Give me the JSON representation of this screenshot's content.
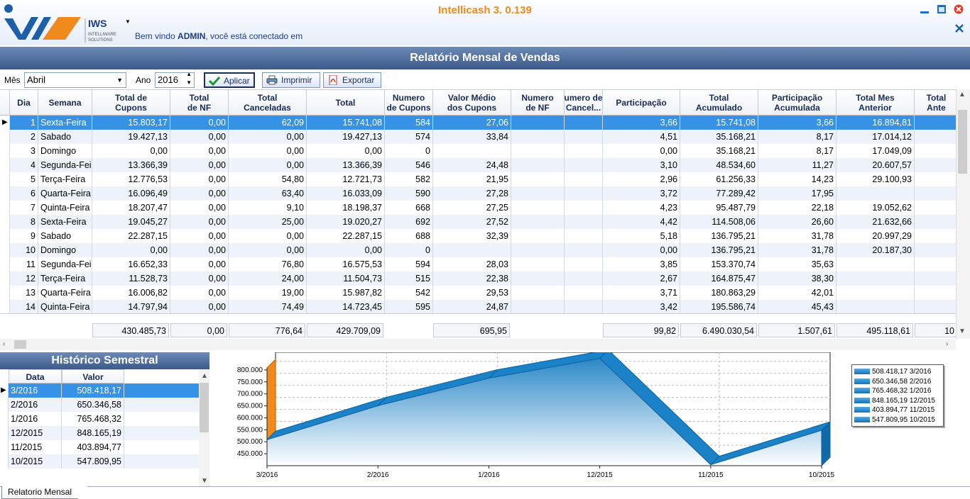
{
  "app": {
    "title": "Intellicash 3. 0.139",
    "logo_text": "IWS",
    "logo_sub1": "INTELLIWARE",
    "logo_sub2": "SOLUTIONS",
    "welcome_prefix": "Bem vindo ",
    "welcome_user": "ADMIN",
    "welcome_suffix": ", você está conectado em"
  },
  "report": {
    "title": "Relatório Mensal de Vendas"
  },
  "toolbar": {
    "mes_label": "Mês",
    "mes_value": "Abril",
    "ano_label": "Ano",
    "ano_value": "2016",
    "aplicar": "Aplicar",
    "imprimir": "Imprimir",
    "exportar": "Exportar"
  },
  "grid": {
    "columns": [
      {
        "l1": "Dia",
        "l2": ""
      },
      {
        "l1": "Semana",
        "l2": ""
      },
      {
        "l1": "Total de",
        "l2": "Cupons"
      },
      {
        "l1": "Total",
        "l2": "de NF"
      },
      {
        "l1": "Total",
        "l2": "Canceladas"
      },
      {
        "l1": "Total",
        "l2": ""
      },
      {
        "l1": "Numero",
        "l2": "de Cupons"
      },
      {
        "l1": "Valor Médio",
        "l2": "dos Cupons"
      },
      {
        "l1": "Numero",
        "l2": "de NF"
      },
      {
        "l1": "umero de",
        "l2": "Cancel..."
      },
      {
        "l1": "Participação",
        "l2": ""
      },
      {
        "l1": "Total",
        "l2": "Acumulado"
      },
      {
        "l1": "Participação",
        "l2": "Acumulada"
      },
      {
        "l1": "Total Mes",
        "l2": "Anterior"
      },
      {
        "l1": "Total",
        "l2": "Ante"
      }
    ],
    "rows": [
      [
        "1",
        "Sexta-Feira",
        "15.803,17",
        "0,00",
        "62,09",
        "15.741,08",
        "584",
        "27,06",
        "",
        "",
        "3,66",
        "15.741,08",
        "3,66",
        "16.894,81",
        ""
      ],
      [
        "2",
        "Sabado",
        "19.427,13",
        "0,00",
        "0,00",
        "19.427,13",
        "574",
        "33,84",
        "",
        "",
        "4,51",
        "35.168,21",
        "8,17",
        "17.014,12",
        ""
      ],
      [
        "3",
        "Domingo",
        "0,00",
        "0,00",
        "0,00",
        "0,00",
        "0",
        "",
        "",
        "",
        "0,00",
        "35.168,21",
        "8,17",
        "17.049,09",
        ""
      ],
      [
        "4",
        "Segunda-Feira",
        "13.366,39",
        "0,00",
        "0,00",
        "13.366,39",
        "546",
        "24,48",
        "",
        "",
        "3,10",
        "48.534,60",
        "11,27",
        "20.607,57",
        ""
      ],
      [
        "5",
        "Terça-Feira",
        "12.776,53",
        "0,00",
        "54,80",
        "12.721,73",
        "582",
        "21,95",
        "",
        "",
        "2,96",
        "61.256,33",
        "14,23",
        "29.100,93",
        ""
      ],
      [
        "6",
        "Quarta-Feira",
        "16.096,49",
        "0,00",
        "63,40",
        "16.033,09",
        "590",
        "27,28",
        "",
        "",
        "3,72",
        "77.289,42",
        "17,95",
        "",
        ""
      ],
      [
        "7",
        "Quinta-Feira",
        "18.207,47",
        "0,00",
        "9,10",
        "18.198,37",
        "668",
        "27,25",
        "",
        "",
        "4,23",
        "95.487,79",
        "22,18",
        "19.052,62",
        ""
      ],
      [
        "8",
        "Sexta-Feira",
        "19.045,27",
        "0,00",
        "25,00",
        "19.020,27",
        "692",
        "27,52",
        "",
        "",
        "4,42",
        "114.508,06",
        "26,60",
        "21.632,66",
        ""
      ],
      [
        "9",
        "Sabado",
        "22.287,15",
        "0,00",
        "0,00",
        "22.287,15",
        "688",
        "32,39",
        "",
        "",
        "5,18",
        "136.795,21",
        "31,78",
        "20.997,29",
        ""
      ],
      [
        "10",
        "Domingo",
        "0,00",
        "0,00",
        "0,00",
        "0,00",
        "0",
        "",
        "",
        "",
        "0,00",
        "136.795,21",
        "31,78",
        "20.187,30",
        ""
      ],
      [
        "11",
        "Segunda-Feira",
        "16.652,33",
        "0,00",
        "76,80",
        "16.575,53",
        "594",
        "28,03",
        "",
        "",
        "3,85",
        "153.370,74",
        "35,63",
        "",
        ""
      ],
      [
        "12",
        "Terça-Feira",
        "11.528,73",
        "0,00",
        "24,00",
        "11.504,73",
        "515",
        "22,38",
        "",
        "",
        "2,67",
        "164.875,47",
        "38,30",
        "",
        ""
      ],
      [
        "13",
        "Quarta-Feira",
        "16.006,82",
        "0,00",
        "19,00",
        "15.987,82",
        "542",
        "29,53",
        "",
        "",
        "3,71",
        "180.863,29",
        "42,01",
        "",
        ""
      ],
      [
        "14",
        "Quinta-Feira",
        "14.797,94",
        "0,00",
        "74,49",
        "14.723,45",
        "595",
        "24,87",
        "",
        "",
        "3,42",
        "195.586,74",
        "45,43",
        "",
        ""
      ]
    ],
    "totals": [
      "430.485,73",
      "0,00",
      "776,64",
      "429.709,09",
      "695,95",
      "99,82",
      "6.490.030,54",
      "1.507,61",
      "495.118,61",
      "10"
    ]
  },
  "history": {
    "title": "Histórico Semestral",
    "col_data": "Data",
    "col_valor": "Valor",
    "rows": [
      [
        "3/2016",
        "508.418,17"
      ],
      [
        "2/2016",
        "650.346,58"
      ],
      [
        "1/2016",
        "765.468,32"
      ],
      [
        "12/2015",
        "848.165,19"
      ],
      [
        "11/2015",
        "403.894,77"
      ],
      [
        "10/2015",
        "547.809,95"
      ]
    ]
  },
  "chart_data": {
    "type": "area",
    "categories": [
      "3/2016",
      "2/2016",
      "1/2016",
      "12/2015",
      "11/2015",
      "10/2015"
    ],
    "values": [
      508418.17,
      650346.58,
      765468.32,
      848165.19,
      403894.77,
      547809.95
    ],
    "ylim": [
      400000,
      850000
    ],
    "yticks": [
      "800.000",
      "750.000",
      "700.000",
      "650.000",
      "600.000",
      "550.000",
      "500.000",
      "450.000"
    ],
    "ytick_values": [
      800000,
      750000,
      700000,
      650000,
      600000,
      550000,
      500000,
      450000
    ],
    "grid": true,
    "legend_position": "right",
    "legend": [
      "508.418,17 3/2016",
      "650.346,58 2/2016",
      "765.468,32 1/2016",
      "848.165,19 12/2015",
      "403.894,77 11/2015",
      "547.809,95 10/2015"
    ],
    "colors": {
      "fill": "#1b82c8",
      "edge": "#0b5f9e",
      "wall": "#f08a1c"
    }
  },
  "tabs": {
    "active": "Relatorio Mensal"
  },
  "icons": [
    "logo-icon",
    "minimize-icon",
    "maximize-icon",
    "close-icon",
    "close-x-icon",
    "checkmark-icon",
    "printer-icon",
    "pdf-icon",
    "row-pointer-icon"
  ]
}
